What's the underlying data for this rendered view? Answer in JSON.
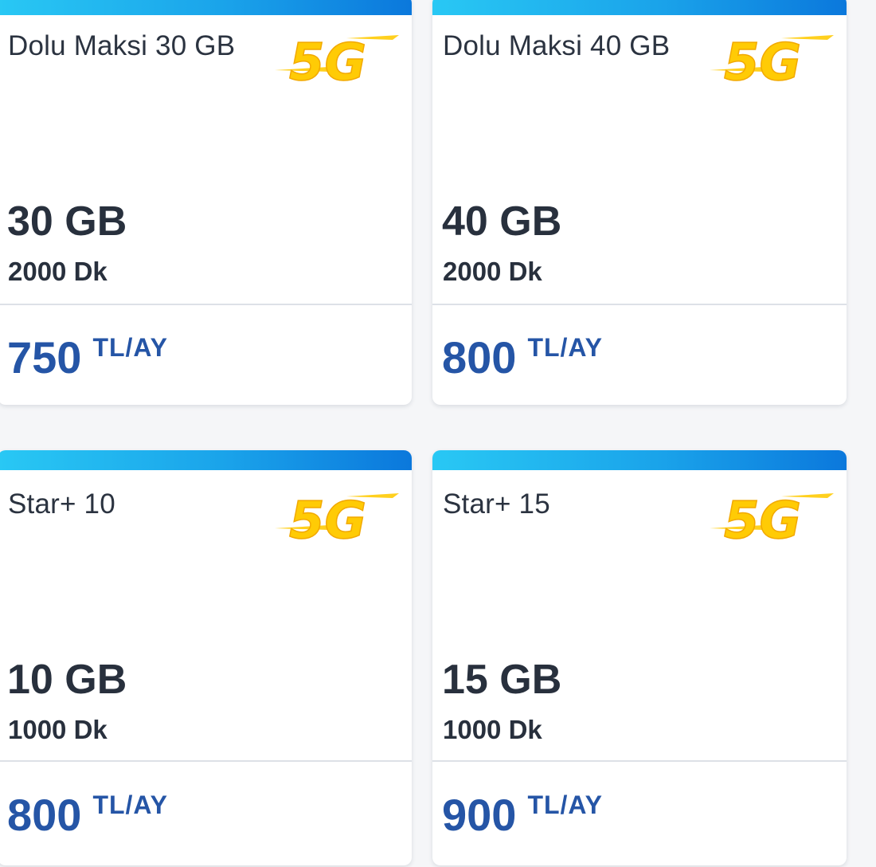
{
  "plans": [
    {
      "name": "Dolu Maksi 30 GB",
      "badge": "5G",
      "data": "30 GB",
      "minutes": "2000 Dk",
      "price": "750",
      "price_unit": "TL/AY"
    },
    {
      "name": "Dolu Maksi 40 GB",
      "badge": "5G",
      "data": "40 GB",
      "minutes": "2000 Dk",
      "price": "800",
      "price_unit": "TL/AY"
    },
    {
      "name": "Star+ 10",
      "badge": "5G",
      "data": "10 GB",
      "minutes": "1000 Dk",
      "price": "800",
      "price_unit": "TL/AY"
    },
    {
      "name": "Star+ 15",
      "badge": "5G",
      "data": "15 GB",
      "minutes": "1000 Dk",
      "price": "900",
      "price_unit": "TL/AY"
    }
  ],
  "colors": {
    "accent_gradient_start": "#29c8f4",
    "accent_gradient_end": "#0b78dc",
    "badge_yellow": "#ffcb05",
    "price_blue": "#2555a6",
    "text_dark": "#28303d",
    "background": "#f5f6f8"
  },
  "icons": {
    "badge": "5g-logo"
  }
}
